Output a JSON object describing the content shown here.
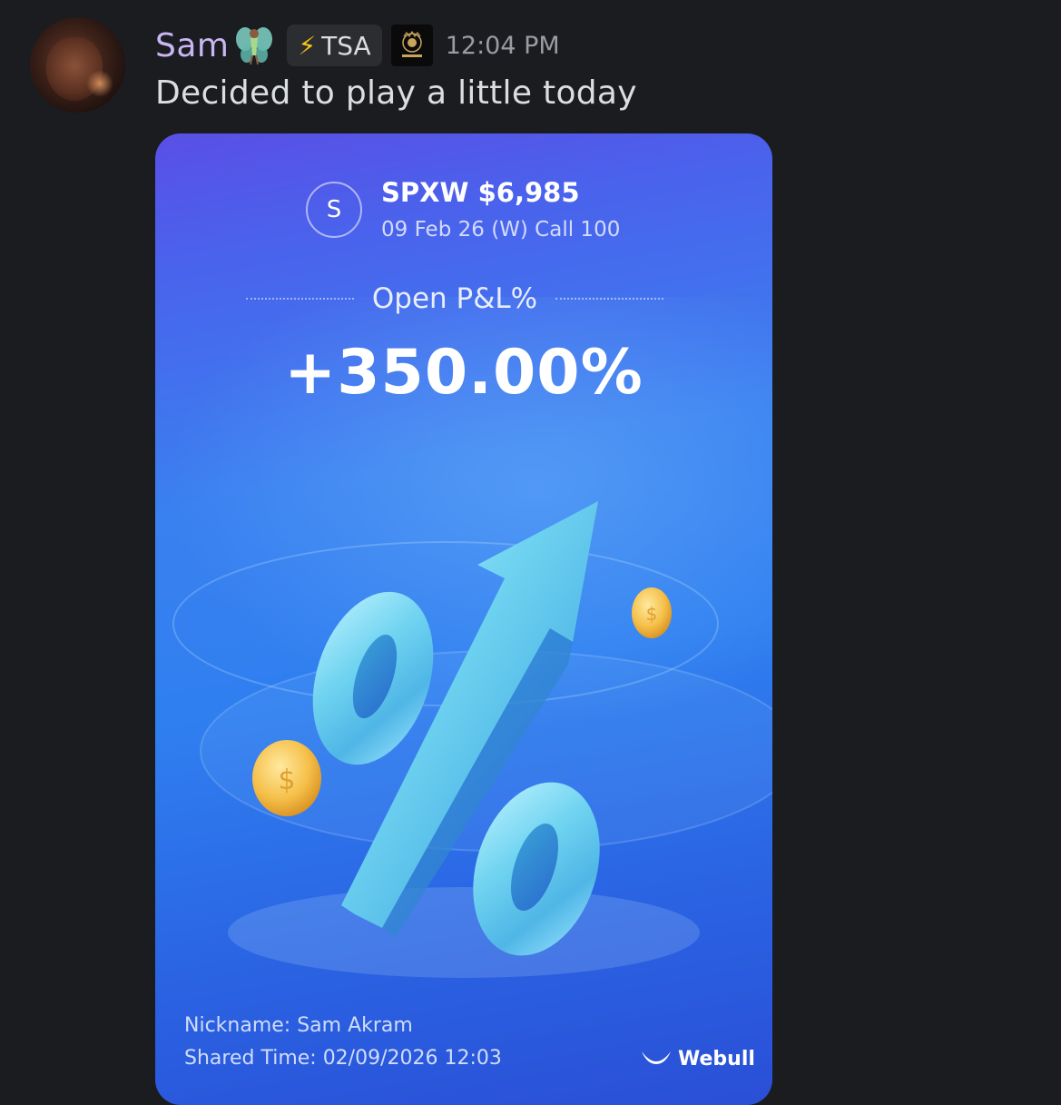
{
  "message": {
    "username": "Sam",
    "username_emoji": "fairy-emoji",
    "role_tag": {
      "icon": "lightning-bolt-icon",
      "label": "TSA"
    },
    "guild_icon": "crest-icon",
    "timestamp": "12:04 PM",
    "text": "Decided to play a little today"
  },
  "card": {
    "ticker_initial": "S",
    "ticker": "SPXW $6,985",
    "contract": "09 Feb 26 (W) Call 100",
    "pnl_label": "Open P&L%",
    "pnl_value": "+350.00%",
    "nickname": "Nickname: Sam Akram",
    "shared_time": "Shared Time: 02/09/2026 12:03",
    "brand": "Webull"
  },
  "colors": {
    "background": "#1b1c20",
    "username": "#c9b6f2",
    "card_gradient_top": "#5a4fe6",
    "card_gradient_bottom": "#2a4fd6"
  }
}
